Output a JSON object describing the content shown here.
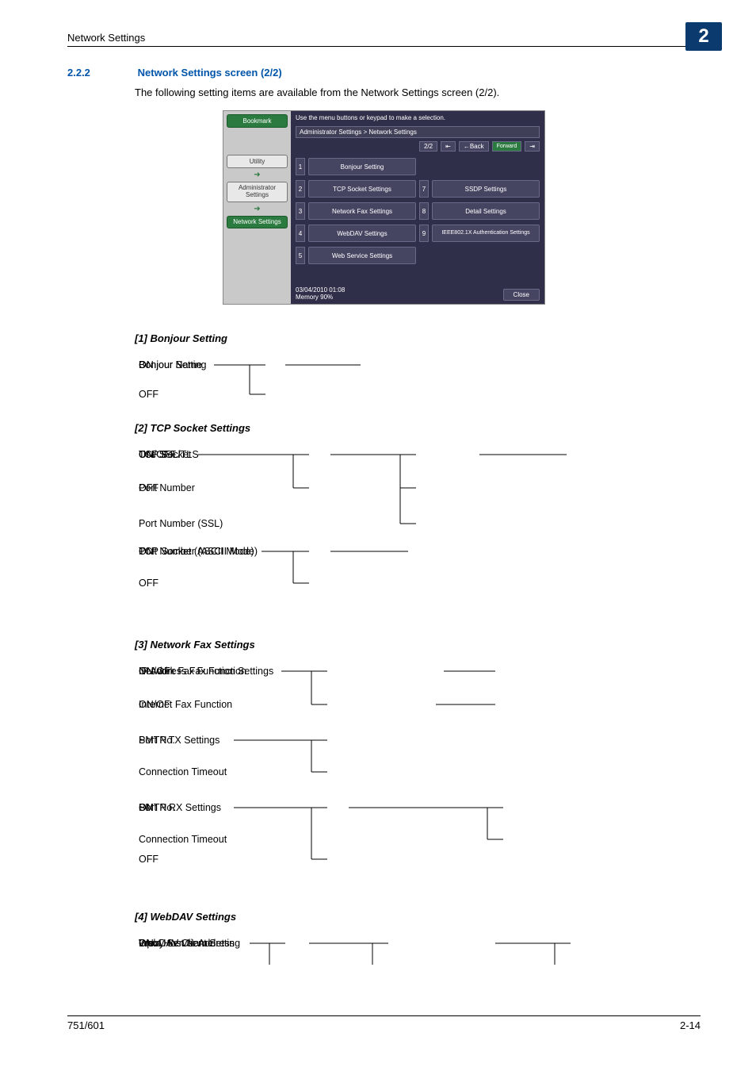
{
  "runningHead": "Network Settings",
  "chapter": "2",
  "sectionNumber": "2.2.2",
  "sectionTitle": "Network Settings screen (2/2)",
  "intro": "The following setting items are available from the Network Settings screen (2/2).",
  "device": {
    "hint": "Use the menu buttons or keypad to make a selection.",
    "breadcrumb": "Administrator Settings > Network Settings",
    "page": "2/2",
    "back": "←Back",
    "forw": "Forward",
    "bookmark": "Bookmark",
    "utility": "Utility",
    "adminSettings": "Administrator Settings",
    "netSettings": "Network Settings",
    "items": [
      "Bonjour Setting",
      "TCP Socket Settings",
      "Network Fax Settings",
      "WebDAV Settings",
      "Web Service Settings",
      "",
      "SSDP Settings",
      "Detail Settings",
      "IEEE802.1X Authentication Settings"
    ],
    "dateLine": "03/04/2010   01:08",
    "memLine": "Memory       90%",
    "close": "Close"
  },
  "s1": {
    "head": "[1] Bonjour Setting",
    "a": "Bonjour Setting",
    "b": "ON",
    "c": "OFF",
    "d": "Bonjour Name"
  },
  "s2": {
    "head": "[2] TCP Socket Settings",
    "a": "TCP Socket",
    "b": "ON",
    "c": "OFF",
    "d": "Use SSL/TLS",
    "e": "ON/OFF",
    "f": "Port Number",
    "g": "Port Number (SSL)",
    "h": "TCP Socket (ASCII Mode)",
    "i": "ON",
    "j": "OFF",
    "k": "Port Number (ASCII Mode)"
  },
  "s3": {
    "head": "[3] Network Fax Settings",
    "a": "Network Fax Function Settings",
    "b": "IP Address Fax Function",
    "c": "ON/OF",
    "d": "Internet Fax Function",
    "e": "ON/OF",
    "f": "SMTP TX Settings",
    "g": "Port No.",
    "h": "Connection Timeout",
    "i": "SMTP RX Settings",
    "j": "ON",
    "k": "OFF",
    "l": "Port No.",
    "m": "Connection Timeout"
  },
  "s4": {
    "head": "[4] WebDAV Settings",
    "a": "WebDAV Client Setting",
    "b": "ON",
    "c": "Proxy Server Address",
    "d": "Input Host Name"
  },
  "footerLeft": "751/601",
  "footerRight": "2-14"
}
